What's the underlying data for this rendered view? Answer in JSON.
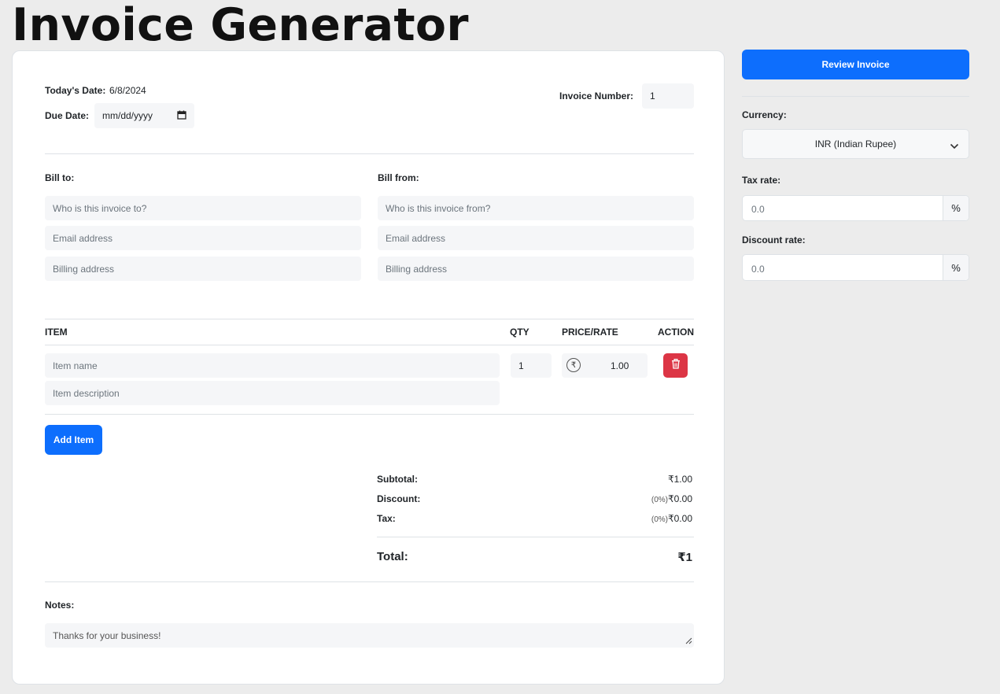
{
  "page": {
    "title": "Invoice Generator"
  },
  "header": {
    "todays_date_label": "Today's Date:",
    "todays_date_value": "6/8/2024",
    "due_date_label": "Due Date:",
    "due_date_placeholder": "mm/dd/yyyy",
    "invoice_number_label": "Invoice Number:",
    "invoice_number_value": "1"
  },
  "bill_to": {
    "label": "Bill to:",
    "name_placeholder": "Who is this invoice to?",
    "email_placeholder": "Email address",
    "address_placeholder": "Billing address"
  },
  "bill_from": {
    "label": "Bill from:",
    "name_placeholder": "Who is this invoice from?",
    "email_placeholder": "Email address",
    "address_placeholder": "Billing address"
  },
  "items_table": {
    "headers": {
      "item": "ITEM",
      "qty": "QTY",
      "price": "PRICE/RATE",
      "action": "ACTION"
    },
    "rows": [
      {
        "name_placeholder": "Item name",
        "description_placeholder": "Item description",
        "qty": "1",
        "currency_symbol": "₹",
        "price": "1.00"
      }
    ],
    "add_item_label": "Add Item",
    "delete_icon": "trash-icon"
  },
  "summary": {
    "subtotal_label": "Subtotal:",
    "subtotal_value": "₹1.00",
    "discount_label": "Discount:",
    "discount_pct": "(0%)",
    "discount_value": "₹0.00",
    "tax_label": "Tax:",
    "tax_pct": "(0%)",
    "tax_value": "₹0.00",
    "total_label": "Total:",
    "total_value": "₹1"
  },
  "notes": {
    "label": "Notes:",
    "value": "Thanks for your business!"
  },
  "sidebar": {
    "review_button_label": "Review Invoice",
    "currency_label": "Currency:",
    "currency_value": "INR (Indian Rupee)",
    "tax_rate_label": "Tax rate:",
    "tax_rate_placeholder": "0.0",
    "discount_rate_label": "Discount rate:",
    "discount_rate_placeholder": "0.0",
    "percent_symbol": "%"
  },
  "colors": {
    "primary": "#0d6efd",
    "danger": "#dc3545",
    "background": "#ececec"
  }
}
